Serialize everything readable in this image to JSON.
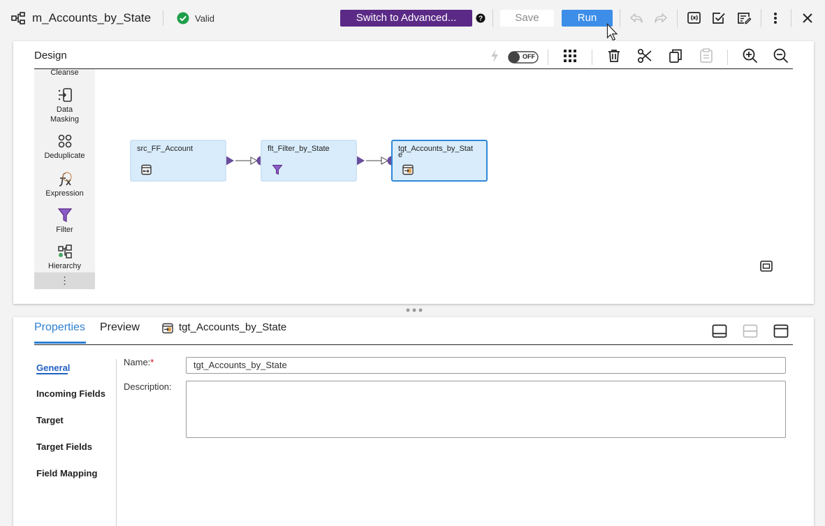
{
  "header": {
    "mapping_name": "m_Accounts_by_State",
    "status": "Valid",
    "switch_advanced_label": "Switch to Advanced...",
    "save_label": "Save",
    "run_label": "Run"
  },
  "design": {
    "title": "Design",
    "toggle_label": "OFF",
    "palette": [
      {
        "label": "Cleanse",
        "icon": "cleanse-icon"
      },
      {
        "label": "Data Masking",
        "icon": "data-masking-icon"
      },
      {
        "label": "Deduplicate",
        "icon": "deduplicate-icon"
      },
      {
        "label": "Expression",
        "icon": "expression-icon"
      },
      {
        "label": "Filter",
        "icon": "filter-icon"
      },
      {
        "label": "Hierarchy",
        "icon": "hierarchy-icon"
      }
    ],
    "nodes": [
      {
        "label": "src_FF_Account",
        "icon": "source-icon"
      },
      {
        "label": "flt_Filter_by_State",
        "icon": "filter-icon"
      },
      {
        "label": "tgt_Accounts_by_State",
        "icon": "target-icon"
      }
    ]
  },
  "properties": {
    "tabs": [
      "Properties",
      "Preview"
    ],
    "selected_object": "tgt_Accounts_by_State",
    "sections": [
      "General",
      "Incoming Fields",
      "Target",
      "Target Fields",
      "Field Mapping"
    ],
    "name_label": "Name:",
    "name_required": "*",
    "name_value": "tgt_Accounts_by_State",
    "description_label": "Description:",
    "description_value": ""
  },
  "colors": {
    "accent": "#2f7fd1",
    "advanced_button": "#5b2a86",
    "run_button": "#3d8ee8",
    "valid": "#1e9e4a",
    "node_fill": "#d9ecfb",
    "port": "#6a4c9c"
  }
}
